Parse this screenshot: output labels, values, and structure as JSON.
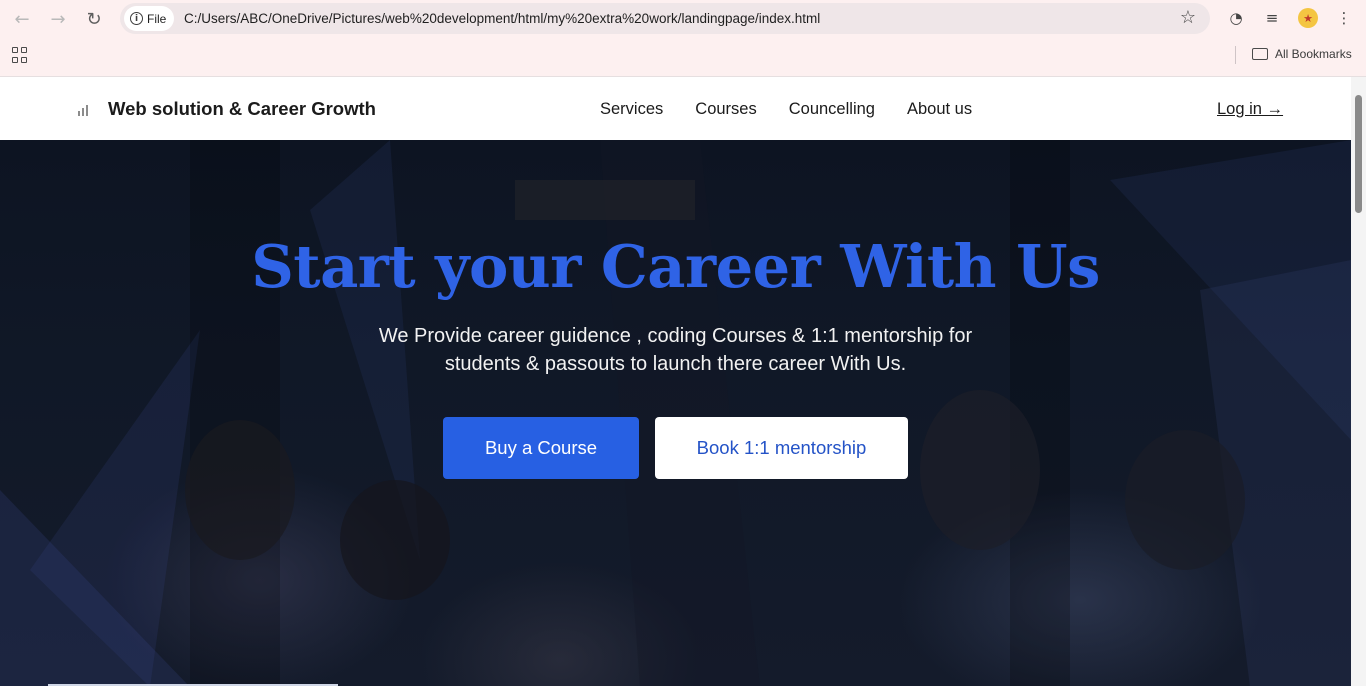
{
  "browser": {
    "site_chip": "File",
    "url": "C:/Users/ABC/OneDrive/Pictures/web%20development/html/my%20extra%20work/landingpage/index.html",
    "bookmarks_label": "All Bookmarks",
    "icons": {
      "back": "back-arrow-icon",
      "forward": "forward-arrow-icon",
      "reload": "reload-icon",
      "info": "info-icon",
      "star": "star-icon",
      "apps": "apps-grid-icon",
      "folder": "folder-icon"
    }
  },
  "site": {
    "brand": "Web solution & Career Growth",
    "nav": [
      {
        "label": "Services"
      },
      {
        "label": "Courses"
      },
      {
        "label": "Councelling"
      },
      {
        "label": "About us"
      }
    ],
    "login": "Log in →"
  },
  "hero": {
    "title": "Start your Career With Us",
    "subtitle": "We Provide career guidence , coding Courses & 1:1 mentorship for students & passouts to launch there career With Us.",
    "primary_button": "Buy a Course",
    "secondary_button": "Book 1:1 mentorship"
  },
  "colors": {
    "accent": "#2760e3",
    "title": "#2f63e6",
    "hero_bg": "#101827"
  }
}
